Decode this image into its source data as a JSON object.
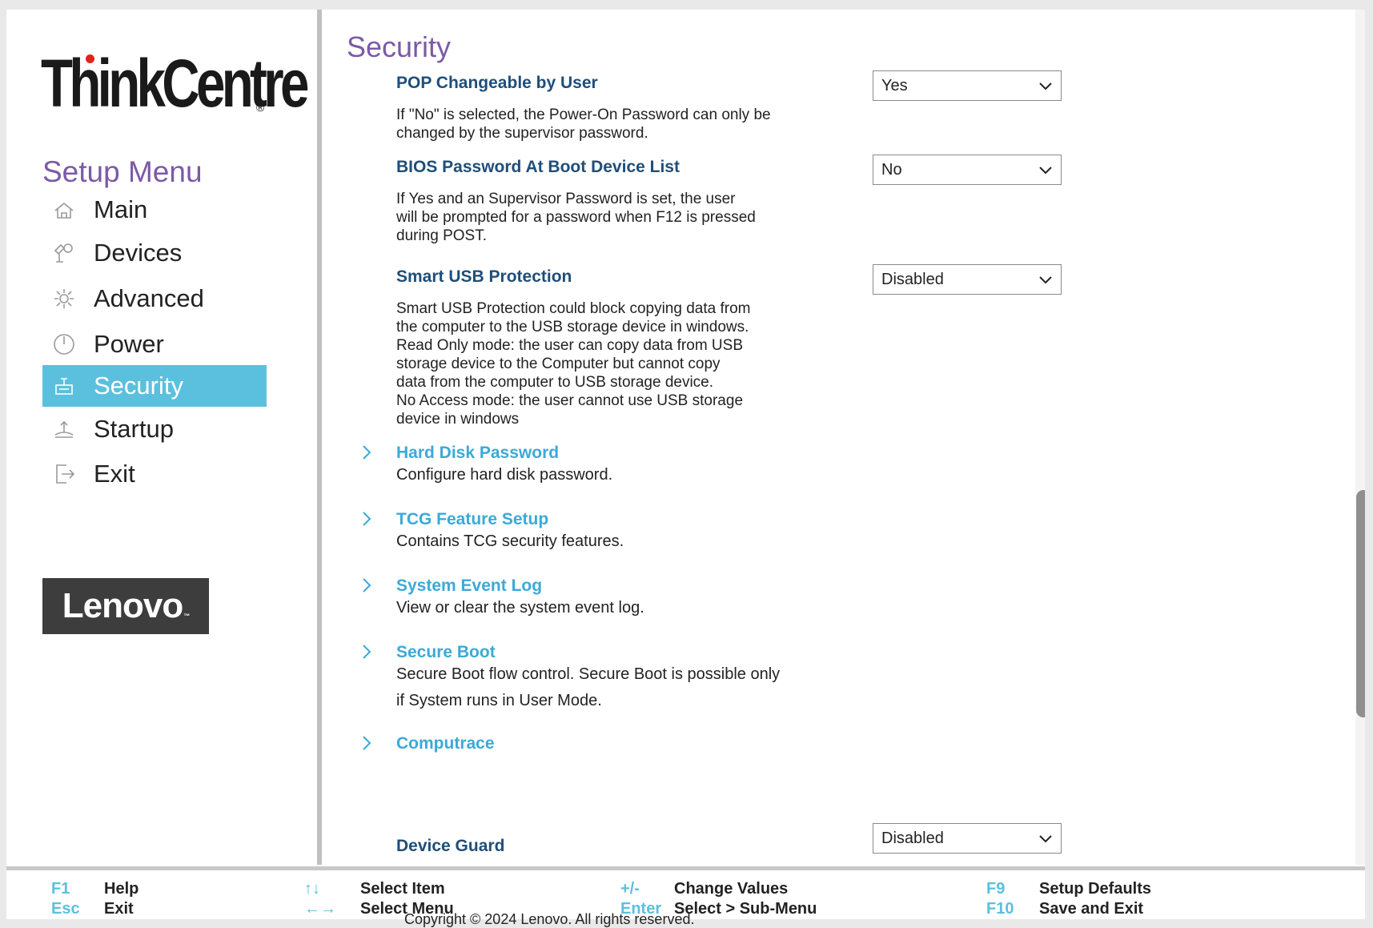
{
  "sidebar": {
    "logo_text": "ThinkCentre",
    "logo_reg": "®",
    "title": "Setup Menu",
    "items": [
      {
        "label": "Main",
        "icon": "home-icon"
      },
      {
        "label": "Devices",
        "icon": "devices-icon"
      },
      {
        "label": "Advanced",
        "icon": "gear-icon"
      },
      {
        "label": "Power",
        "icon": "power-icon"
      },
      {
        "label": "Security",
        "icon": "security-icon",
        "active": true
      },
      {
        "label": "Startup",
        "icon": "startup-icon"
      },
      {
        "label": "Exit",
        "icon": "exit-icon"
      }
    ],
    "brand": "Lenovo",
    "brand_tm": "™"
  },
  "main": {
    "title": "Security",
    "settings": [
      {
        "label": "POP Changeable by User",
        "value": "Yes",
        "description": "If \"No\" is selected, the Power-On Password can only be\nchanged by the supervisor password."
      },
      {
        "label": "BIOS Password At Boot Device List",
        "value": "No",
        "description": "If Yes and an Supervisor Password is set, the user\nwill be prompted for a password when F12 is pressed\nduring POST."
      },
      {
        "label": "Smart USB Protection",
        "value": "Disabled",
        "description": "Smart USB Protection could block copying data from\nthe computer to the USB storage device in windows.\nRead Only mode: the user can copy data from USB\nstorage device to the Computer but cannot copy\ndata from the computer to USB storage device.\nNo Access mode: the user cannot use USB storage\ndevice in windows"
      }
    ],
    "submenus": [
      {
        "label": "Hard Disk Password",
        "description": "Configure hard disk password."
      },
      {
        "label": "TCG Feature Setup",
        "description": "Contains TCG security features."
      },
      {
        "label": "System Event Log",
        "description": "View or clear the system event log."
      },
      {
        "label": "Secure Boot",
        "description": "Secure Boot flow control. Secure Boot is possible only\nif System runs in User Mode."
      },
      {
        "label": "Computrace",
        "description": ""
      }
    ],
    "device_guard": {
      "label": "Device Guard",
      "value": "Disabled"
    }
  },
  "footer": {
    "items": [
      {
        "key": "F1",
        "desc": "Help"
      },
      {
        "key": "Esc",
        "desc": "Exit"
      },
      {
        "key": "↑↓",
        "desc": "Select Item"
      },
      {
        "key": "←→",
        "desc": "Select Menu"
      },
      {
        "key": "+/-",
        "desc": "Change Values"
      },
      {
        "key": "Enter",
        "desc": "Select > Sub-Menu"
      },
      {
        "key": "F9",
        "desc": "Setup Defaults"
      },
      {
        "key": "F10",
        "desc": "Save and Exit"
      }
    ],
    "copyright": "Copyright © 2024 Lenovo. All rights reserved."
  },
  "colors": {
    "accent": "#5bc0de",
    "title": "#7b5aa6",
    "setting_label": "#1f4e79",
    "submenu_label": "#3aaad8",
    "logo_dot": "#e2231a"
  }
}
